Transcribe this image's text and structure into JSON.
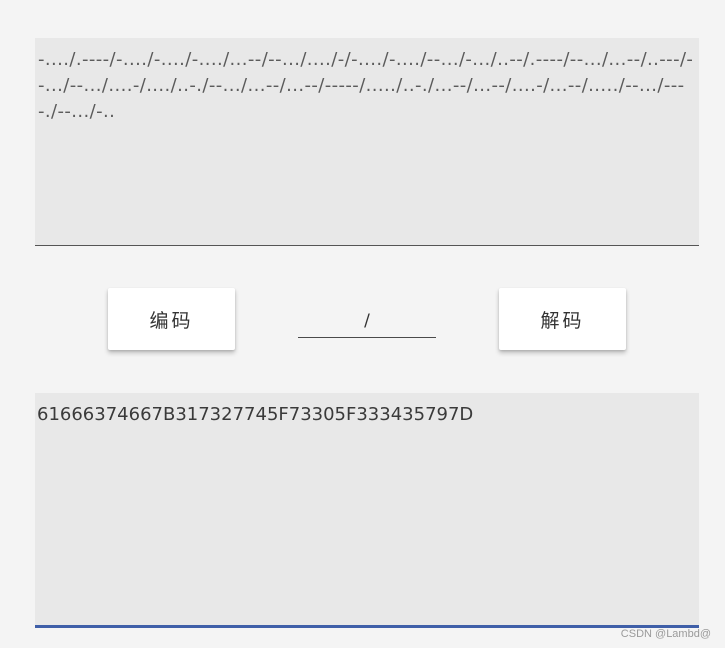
{
  "input": {
    "value": "-..../.----/-..../-..../-..../...--/--.../..../-/-..../-..../--.../-.../..--/.----/--.../...--/..---/--.../--.../....-/..../..-./--.../...--/...--/-----/...../..-./...--/...--/....-/...--/...../--.../----./--.../-.."
  },
  "toolbar": {
    "encode_label": "编码",
    "separator_value": "/",
    "decode_label": "解码"
  },
  "output": {
    "value": "61666374667B317327745F73305F333435797D"
  },
  "footer": {
    "watermark": "CSDN @Lambd@"
  }
}
